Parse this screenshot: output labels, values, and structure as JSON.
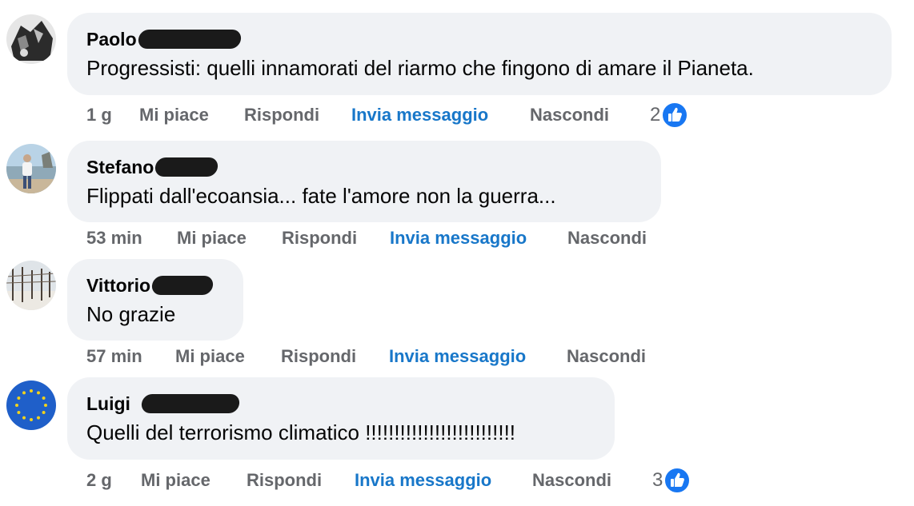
{
  "colors": {
    "bubble": "#f0f2f5",
    "meta_text": "#65676b",
    "message_link": "#1877c9",
    "like_badge": "#1877f2"
  },
  "comments": [
    {
      "author": "Paolo",
      "text": "Progressisti: quelli innamorati del riarmo che fingono di amare il Pianeta.",
      "time": "1 g",
      "like": "Mi piace",
      "reply": "Rispondi",
      "message": "Invia messaggio",
      "hide": "Nascondi",
      "reactions": "2",
      "reaction_icon": "like-icon"
    },
    {
      "author": "Stefano",
      "text": "Flippati dall'ecoansia... fate l'amore non la guerra...",
      "time": "53 min",
      "like": "Mi piace",
      "reply": "Rispondi",
      "message": "Invia messaggio",
      "hide": "Nascondi"
    },
    {
      "author": "Vittorio",
      "text": "No grazie",
      "time": "57 min",
      "like": "Mi piace",
      "reply": "Rispondi",
      "message": "Invia messaggio",
      "hide": "Nascondi"
    },
    {
      "author": "Luigi",
      "text": "Quelli del terrorismo climatico !!!!!!!!!!!!!!!!!!!!!!!!!!",
      "time": "2 g",
      "like": "Mi piace",
      "reply": "Rispondi",
      "message": "Invia messaggio",
      "hide": "Nascondi",
      "reactions": "3",
      "reaction_icon": "like-icon"
    }
  ]
}
